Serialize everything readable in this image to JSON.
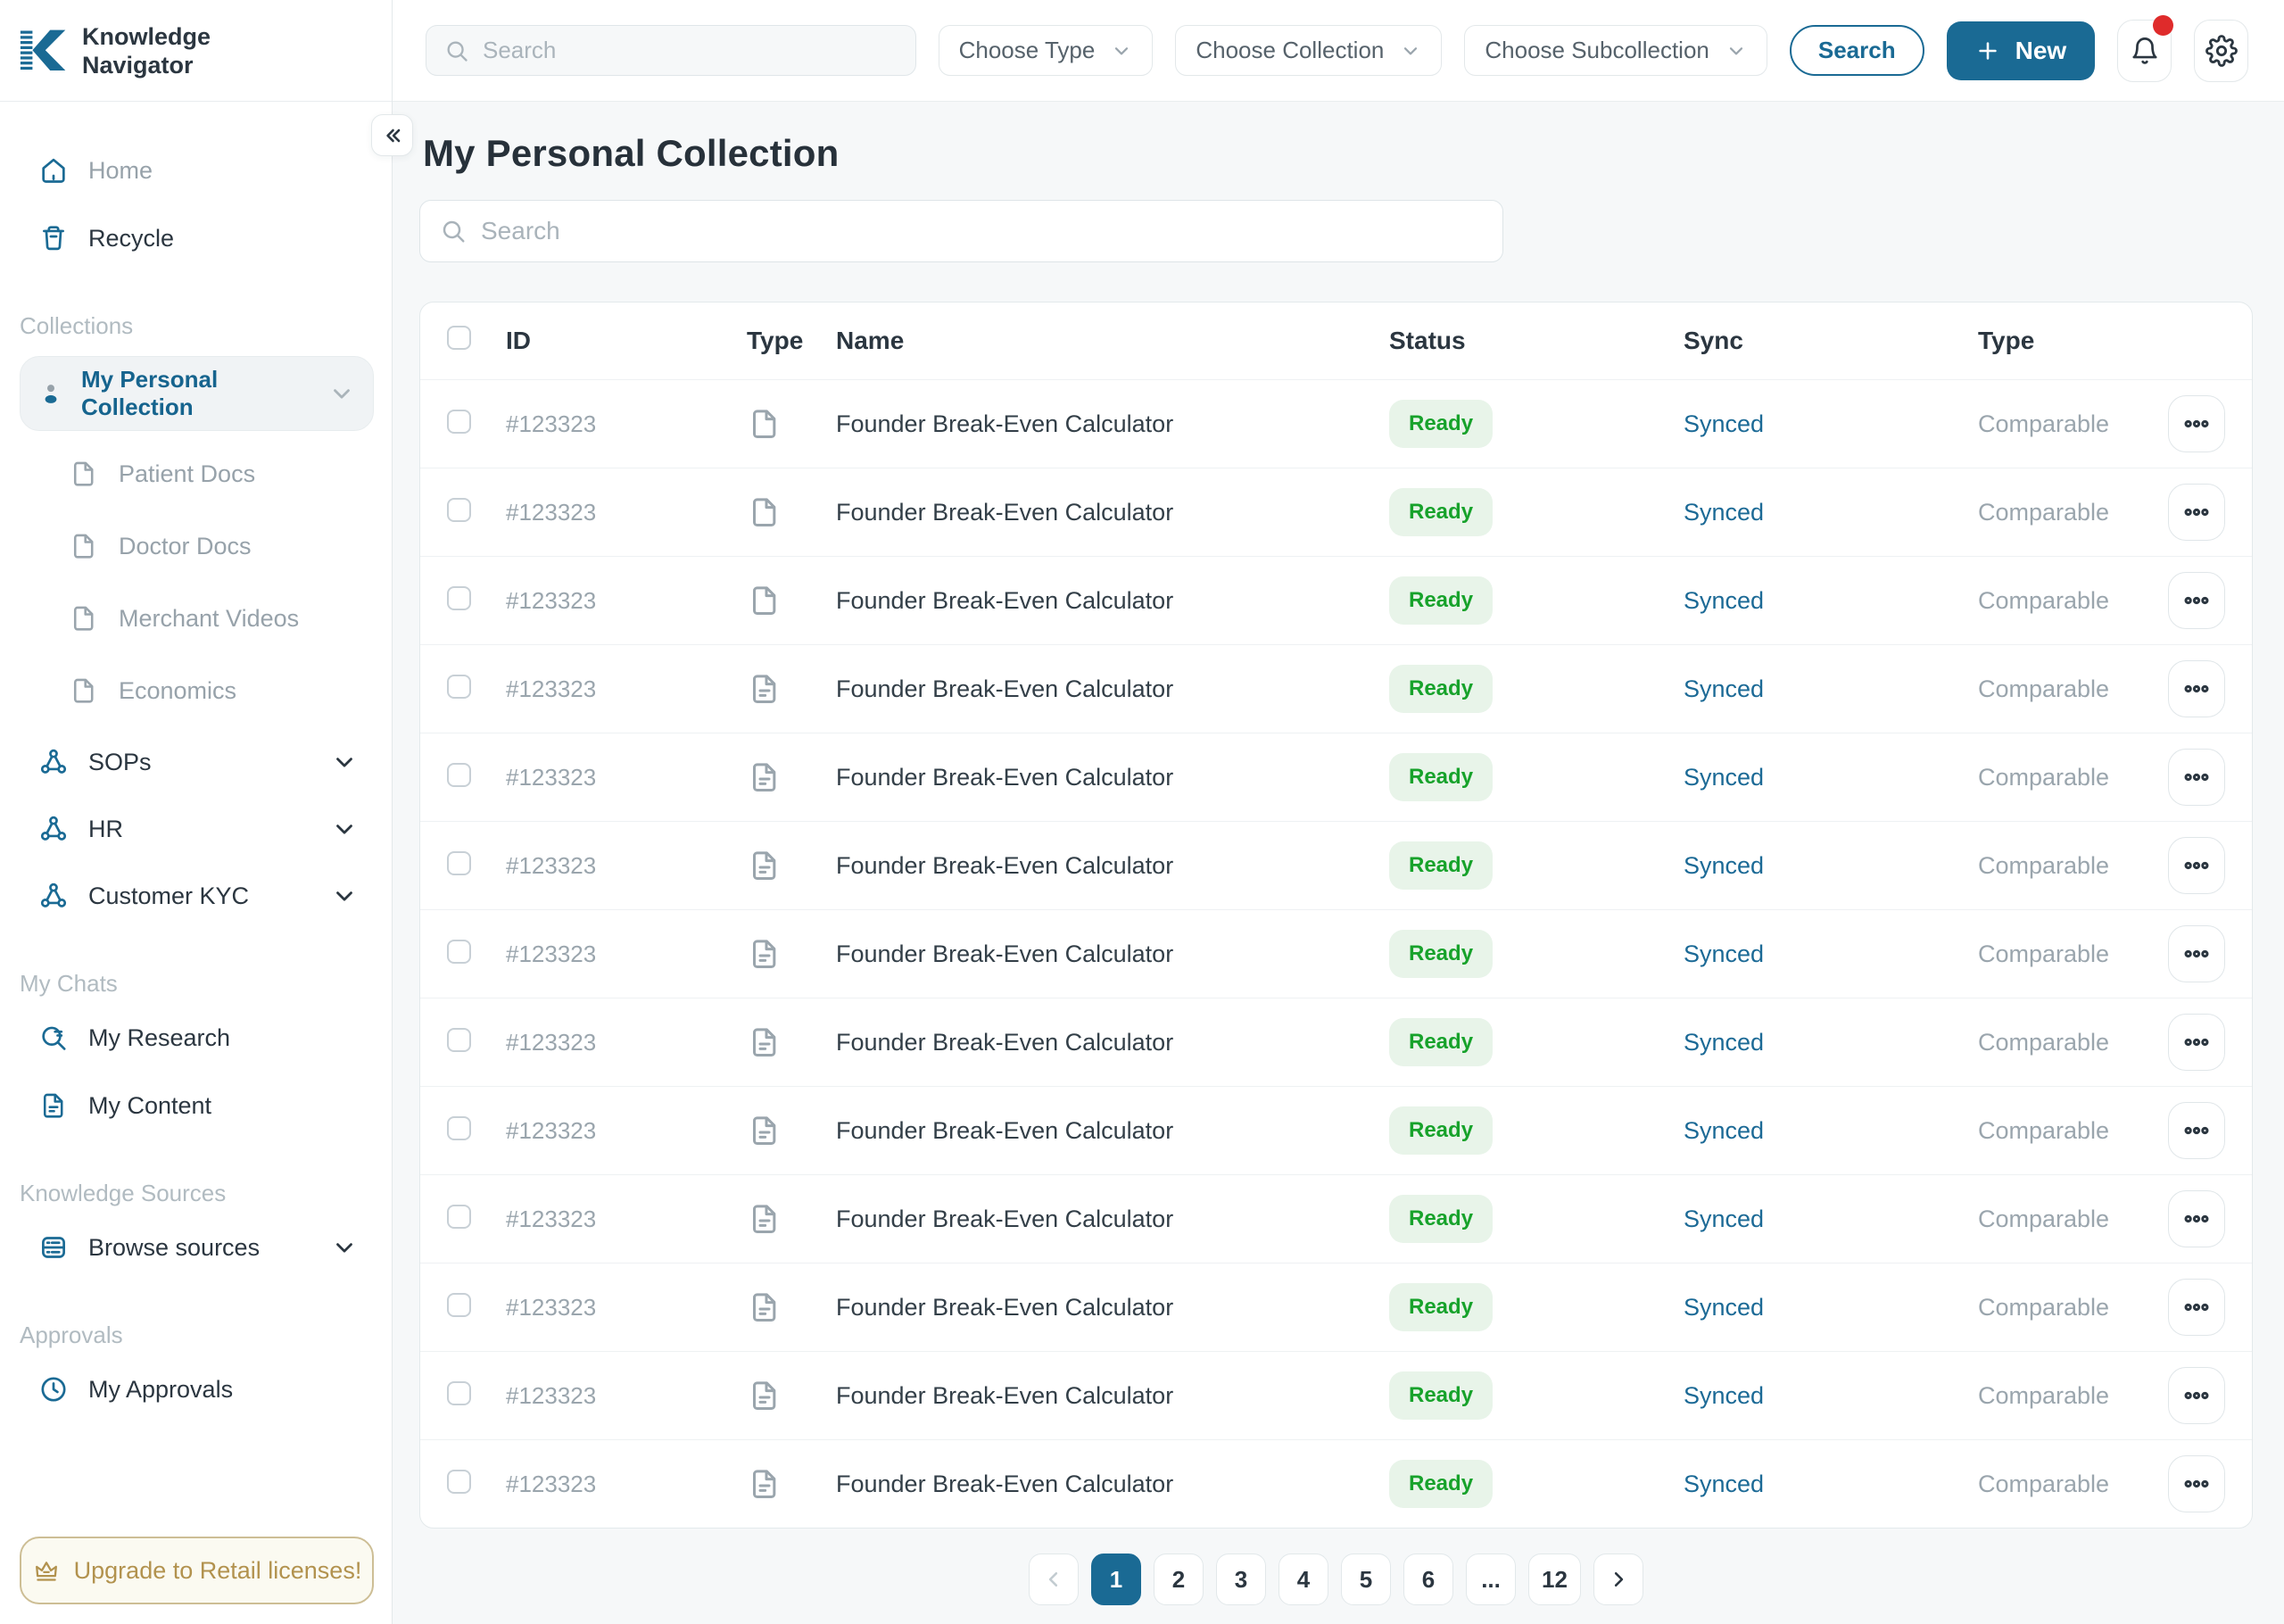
{
  "colors": {
    "brand_blue": "#1a6a94",
    "text_dark": "#2b3640",
    "text_gray": "#9aa5ad",
    "status_green_text": "#17a22b",
    "status_green_bg": "#e8f4e9",
    "sync_blue": "#1c6a96",
    "gold": "#b2924e",
    "notification_red": "#df2b2b"
  },
  "brand": {
    "name_line1": "Knowledge",
    "name_line2": "Navigator"
  },
  "topbar": {
    "search_placeholder": "Search",
    "choose_type": "Choose Type",
    "choose_collection": "Choose Collection",
    "choose_subcollection": "Choose Subcollection",
    "search_button": "Search",
    "new_button": "New"
  },
  "sidebar": {
    "home": "Home",
    "recycle": "Recycle",
    "collections_label": "Collections",
    "personal_collection": "My Personal Collection",
    "sub_items": [
      {
        "label": "Patient Docs"
      },
      {
        "label": "Doctor Docs"
      },
      {
        "label": "Merchant Videos"
      },
      {
        "label": "Economics"
      }
    ],
    "collection_groups": [
      {
        "label": "SOPs"
      },
      {
        "label": "HR"
      },
      {
        "label": "Customer KYC"
      }
    ],
    "my_chats_label": "My Chats",
    "my_research": "My Research",
    "my_content": "My Content",
    "knowledge_sources_label": "Knowledge Sources",
    "browse_sources": "Browse sources",
    "approvals_label": "Approvals",
    "my_approvals": "My Approvals",
    "upgrade_button": "Upgrade to Retail licenses!"
  },
  "main": {
    "title": "My Personal Collection",
    "search_placeholder": "Search",
    "table": {
      "headers": {
        "id": "ID",
        "type": "Type",
        "name": "Name",
        "status": "Status",
        "sync": "Sync",
        "type2": "Type"
      },
      "rows": [
        {
          "id": "#123323",
          "icon": "file-plain",
          "name": "Founder Break-Even Calculator",
          "status": "Ready",
          "sync": "Synced",
          "type": "Comparable"
        },
        {
          "id": "#123323",
          "icon": "file-plain",
          "name": "Founder Break-Even Calculator",
          "status": "Ready",
          "sync": "Synced",
          "type": "Comparable"
        },
        {
          "id": "#123323",
          "icon": "file-plain",
          "name": "Founder Break-Even Calculator",
          "status": "Ready",
          "sync": "Synced",
          "type": "Comparable"
        },
        {
          "id": "#123323",
          "icon": "file-lines",
          "name": "Founder Break-Even Calculator",
          "status": "Ready",
          "sync": "Synced",
          "type": "Comparable"
        },
        {
          "id": "#123323",
          "icon": "file-lines",
          "name": "Founder Break-Even Calculator",
          "status": "Ready",
          "sync": "Synced",
          "type": "Comparable"
        },
        {
          "id": "#123323",
          "icon": "file-lines",
          "name": "Founder Break-Even Calculator",
          "status": "Ready",
          "sync": "Synced",
          "type": "Comparable"
        },
        {
          "id": "#123323",
          "icon": "file-lines",
          "name": "Founder Break-Even Calculator",
          "status": "Ready",
          "sync": "Synced",
          "type": "Comparable"
        },
        {
          "id": "#123323",
          "icon": "file-lines",
          "name": "Founder Break-Even Calculator",
          "status": "Ready",
          "sync": "Synced",
          "type": "Comparable"
        },
        {
          "id": "#123323",
          "icon": "file-lines",
          "name": "Founder Break-Even Calculator",
          "status": "Ready",
          "sync": "Synced",
          "type": "Comparable"
        },
        {
          "id": "#123323",
          "icon": "file-lines",
          "name": "Founder Break-Even Calculator",
          "status": "Ready",
          "sync": "Synced",
          "type": "Comparable"
        },
        {
          "id": "#123323",
          "icon": "file-lines",
          "name": "Founder Break-Even Calculator",
          "status": "Ready",
          "sync": "Synced",
          "type": "Comparable"
        },
        {
          "id": "#123323",
          "icon": "file-lines",
          "name": "Founder Break-Even Calculator",
          "status": "Ready",
          "sync": "Synced",
          "type": "Comparable"
        },
        {
          "id": "#123323",
          "icon": "file-lines",
          "name": "Founder Break-Even Calculator",
          "status": "Ready",
          "sync": "Synced",
          "type": "Comparable"
        }
      ]
    },
    "pagination": {
      "active": "1",
      "pages": [
        "1",
        "2",
        "3",
        "4",
        "5",
        "6",
        "...",
        "12"
      ]
    }
  }
}
